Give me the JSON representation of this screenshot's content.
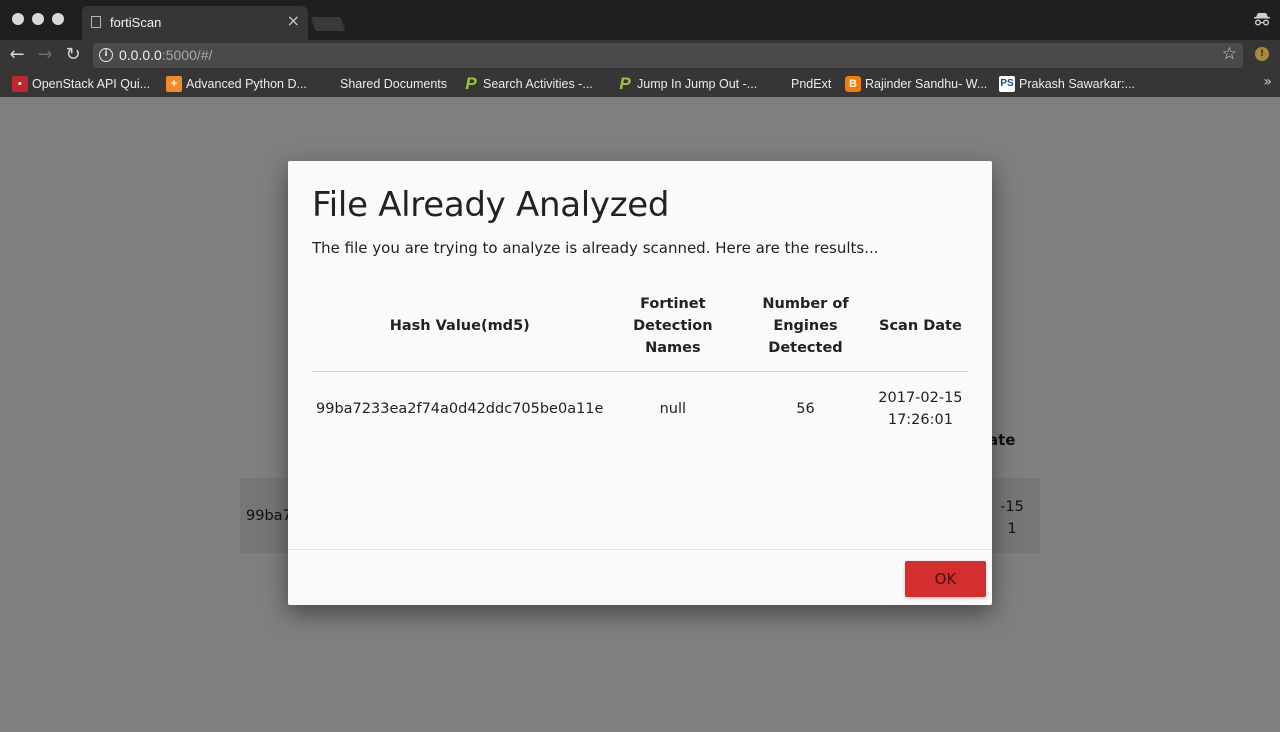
{
  "browser": {
    "tab_title": "fortiScan",
    "tab_close": "×",
    "url_host": "0.0.0.0",
    "url_rest": ":5000/#/",
    "bookmarks": [
      {
        "label": "OpenStack API Qui...",
        "icon": "openstack-icon"
      },
      {
        "label": "Advanced Python D...",
        "icon": "plus-cross-icon"
      },
      {
        "label": "Shared Documents",
        "icon": "page-icon"
      },
      {
        "label": "Search Activities -...",
        "icon": "p-logo-icon"
      },
      {
        "label": "Jump In Jump Out -...",
        "icon": "p-logo-icon"
      },
      {
        "label": "PndExt",
        "icon": "page-icon"
      },
      {
        "label": "Rajinder Sandhu- W...",
        "icon": "blogger-icon"
      },
      {
        "label": "Prakash Sawarkar:...",
        "icon": "ps-icon"
      }
    ],
    "more_bookmarks": "»"
  },
  "background": {
    "header_fragment": "ate",
    "hash_fragment": "99ba7",
    "date_fragment_1": "-15",
    "date_fragment_2": "1"
  },
  "modal": {
    "title": "File Already Analyzed",
    "subtitle": "The file you are trying to analyze is already scanned. Here are the results...",
    "table": {
      "headers": [
        "Hash Value(md5)",
        "Fortinet Detection Names",
        "Number of Engines Detected",
        "Scan Date"
      ],
      "rows": [
        {
          "hash": "99ba7233ea2f74a0d42ddc705be0a11e",
          "detection_names": "null",
          "engines_detected": "56",
          "scan_date_line1": "2017-02-15",
          "scan_date_line2": "17:26:01"
        }
      ]
    },
    "ok_label": "OK"
  },
  "colors": {
    "ok_button": "#d32f2f",
    "overlay": "rgba(0,0,0,0.5)",
    "chrome_dark": "#363636"
  }
}
